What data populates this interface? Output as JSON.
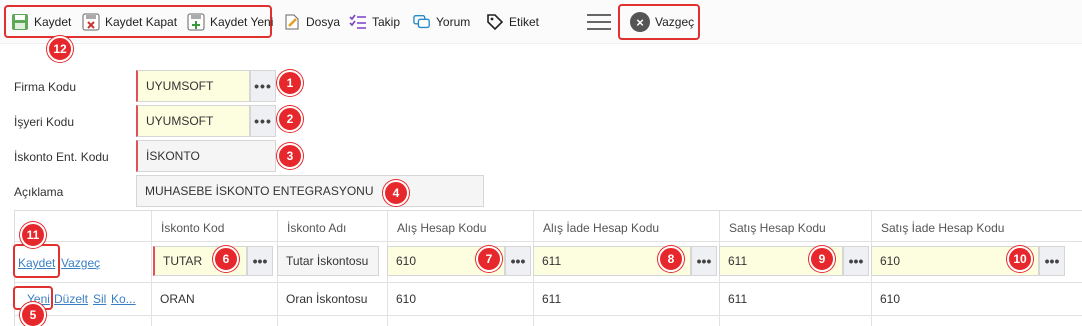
{
  "toolbar": {
    "save": "Kaydet",
    "save_close": "Kaydet Kapat",
    "save_new": "Kaydet Yeni",
    "file": "Dosya",
    "follow": "Takip",
    "comment": "Yorum",
    "tag": "Etiket",
    "cancel": "Vazgeç"
  },
  "form": {
    "firma_label": "Firma Kodu",
    "firma_value": "UYUMSOFT",
    "isyeri_label": "İşyeri Kodu",
    "isyeri_value": "UYUMSOFT",
    "iskonto_label": "İskonto Ent. Kodu",
    "iskonto_value": "İSKONTO",
    "aciklama_label": "Açıklama",
    "aciklama_value": "MUHASEBE İSKONTO ENTEGRASYONU",
    "dots": "•••"
  },
  "grid": {
    "headers": [
      "İskonto Kod",
      "İskonto Adı",
      "Alış Hesap Kodu",
      "Alış İade Hesap Kodu",
      "Satış Hesap Kodu",
      "Satış İade Hesap Kodu"
    ],
    "edit_row": {
      "save_link": "Kaydet",
      "cancel_link": "Vazgeç",
      "kod": "TUTAR",
      "ad": "Tutar İskontosu",
      "alis": "610",
      "alis_iade": "611",
      "satis": "611",
      "satis_iade": "610"
    },
    "row2": {
      "new_link": "Yeni",
      "edit_link": "Düzelt",
      "delete_link": "Sil",
      "copy_link": "Ko...",
      "kod": "ORAN",
      "ad": "Oran İskontosu",
      "alis": "610",
      "alis_iade": "611",
      "satis": "611",
      "satis_iade": "610"
    }
  },
  "badges": [
    "1",
    "2",
    "3",
    "4",
    "5",
    "6",
    "7",
    "8",
    "9",
    "10",
    "11",
    "12"
  ],
  "colors": {
    "required_border": "#e0505a",
    "highlight_red": "#e6272b",
    "required_bg": "#fdfde0",
    "link": "#3a7fc4"
  }
}
